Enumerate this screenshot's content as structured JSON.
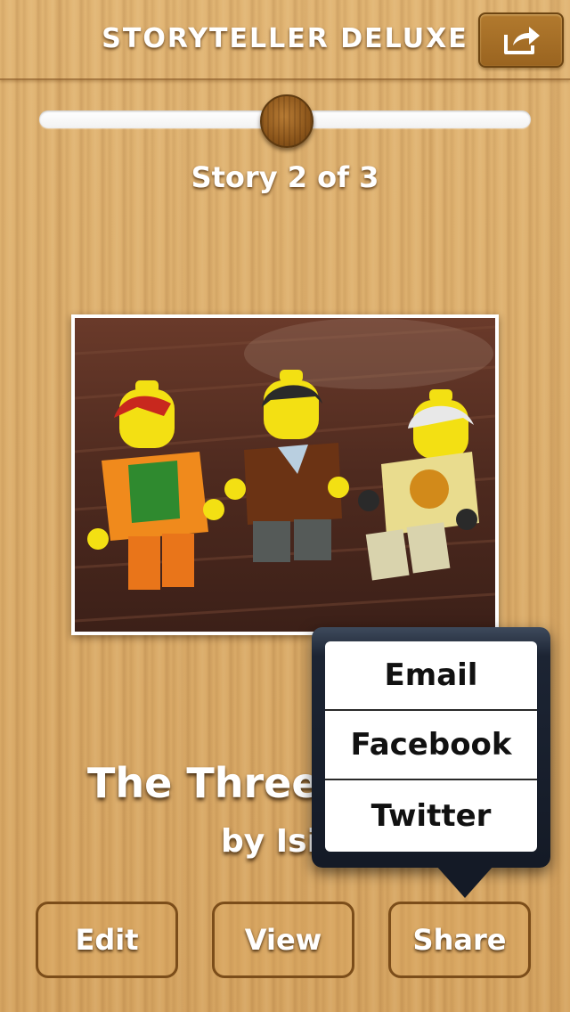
{
  "header": {
    "title": "STORYTELLER DELUXE",
    "share_icon": "share-arrow-icon"
  },
  "slider": {
    "value": 2,
    "min": 1,
    "max": 3
  },
  "story_counter": "Story 2 of 3",
  "photo": {
    "description_icon": "lego-minifigures-photo"
  },
  "story": {
    "title": "The Three",
    "author": "by Isi"
  },
  "buttons": {
    "edit": "Edit",
    "view": "View",
    "share": "Share"
  },
  "share_menu": {
    "items": [
      "Email",
      "Facebook",
      "Twitter"
    ]
  },
  "colors": {
    "wood": "#dcae6c",
    "popover_dark": "#141a26",
    "button_border": "#7b4d1a"
  }
}
